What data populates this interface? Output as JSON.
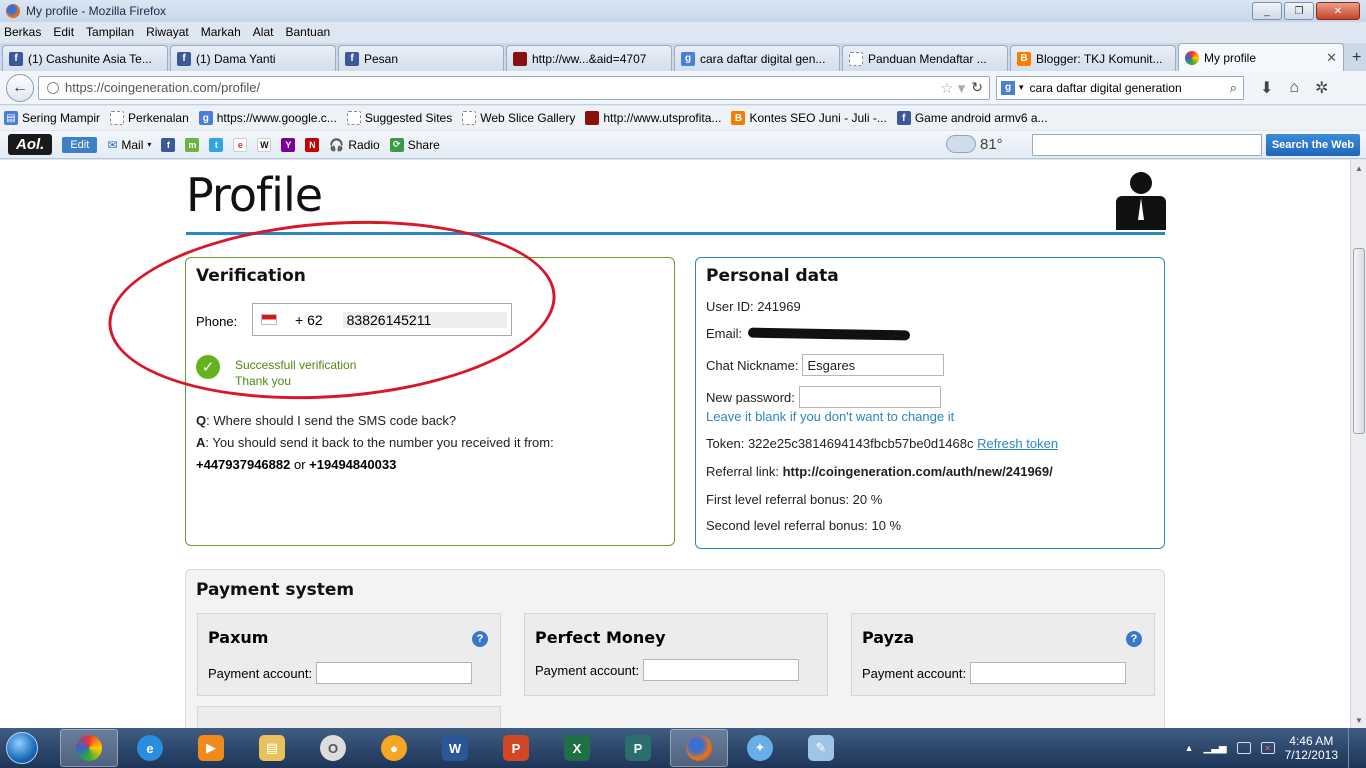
{
  "window": {
    "title": "My profile - Mozilla Firefox",
    "buttons": [
      "_",
      "❐",
      "✕"
    ]
  },
  "menu": [
    "Berkas",
    "Edit",
    "Tampilan",
    "Riwayat",
    "Markah",
    "Alat",
    "Bantuan"
  ],
  "tabs": [
    {
      "label": "(1) Cashunite Asia Te...",
      "icon": "facebook-icon"
    },
    {
      "label": "(1) Dama Yanti",
      "icon": "facebook-icon"
    },
    {
      "label": "Pesan",
      "icon": "facebook-icon"
    },
    {
      "label": "http://ww...&aid=4707",
      "icon": "site-icon"
    },
    {
      "label": "cara daftar digital gen...",
      "icon": "google-icon"
    },
    {
      "label": "Panduan Mendaftar ...",
      "icon": "blank-page-icon"
    },
    {
      "label": "Blogger: TKJ Komunit...",
      "icon": "blogger-icon"
    },
    {
      "label": "My profile",
      "icon": "coingeneration-icon"
    }
  ],
  "nav": {
    "url": "https://coingeneration.com/profile/",
    "search_value": "cara daftar digital generation",
    "search_engine_letter": "g"
  },
  "bookmarks": [
    {
      "label": "Sering Mampir",
      "icon": "bookmark-icon"
    },
    {
      "label": "Perkenalan",
      "icon": "blank-page-icon"
    },
    {
      "label": "https://www.google.c...",
      "icon": "google-icon"
    },
    {
      "label": "Suggested Sites",
      "icon": "blank-page-icon"
    },
    {
      "label": "Web Slice Gallery",
      "icon": "blank-page-icon"
    },
    {
      "label": "http://www.utsprofita...",
      "icon": "site-icon"
    },
    {
      "label": "Kontes SEO Juni - Juli -...",
      "icon": "blogger-icon"
    },
    {
      "label": "Game android armv6 a...",
      "icon": "facebook-icon"
    }
  ],
  "aol": {
    "logo": "Aol.",
    "edit": "Edit",
    "mail": "Mail",
    "radio": "Radio",
    "share": "Share",
    "temperature": "81°",
    "search_button": "Search the Web"
  },
  "page": {
    "title": "Profile",
    "verification": {
      "title": "Verification",
      "phone_label": "Phone:",
      "country_code": "+ 62",
      "phone_number": "83826145211",
      "status_line1": "Successfull verification",
      "status_line2": "Thank you",
      "q_label": "Q",
      "question": ": Where should I send the SMS code back?",
      "a_label": "A",
      "answer": ": You should send it back to the number you received it from:",
      "number1": "+447937946882",
      "or": "or",
      "number2": "+19494840033"
    },
    "personal": {
      "title": "Personal data",
      "user_id_label": "User ID:",
      "user_id": "241969",
      "email_label": "Email:",
      "nickname_label": "Chat Nickname:",
      "nickname": "Esgares",
      "password_label": "New password:",
      "password_hint": "Leave it blank if you don't want to change it",
      "token_label": "Token:",
      "token": "322e25c3814694143fbcb57be0d1468c",
      "refresh": "Refresh token",
      "referral_label": "Referral link:",
      "referral": "http://coingeneration.com/auth/new/241969/",
      "first_level": "First level referral bonus: 20 %",
      "second_level": "Second level referral bonus: 10 %"
    },
    "payment": {
      "title": "Payment system",
      "account_label": "Payment account:",
      "systems": [
        "Paxum",
        "Perfect Money",
        "Payza"
      ],
      "help": "?"
    }
  },
  "taskbar": {
    "time": "4:46 AM",
    "date": "7/12/2013"
  }
}
